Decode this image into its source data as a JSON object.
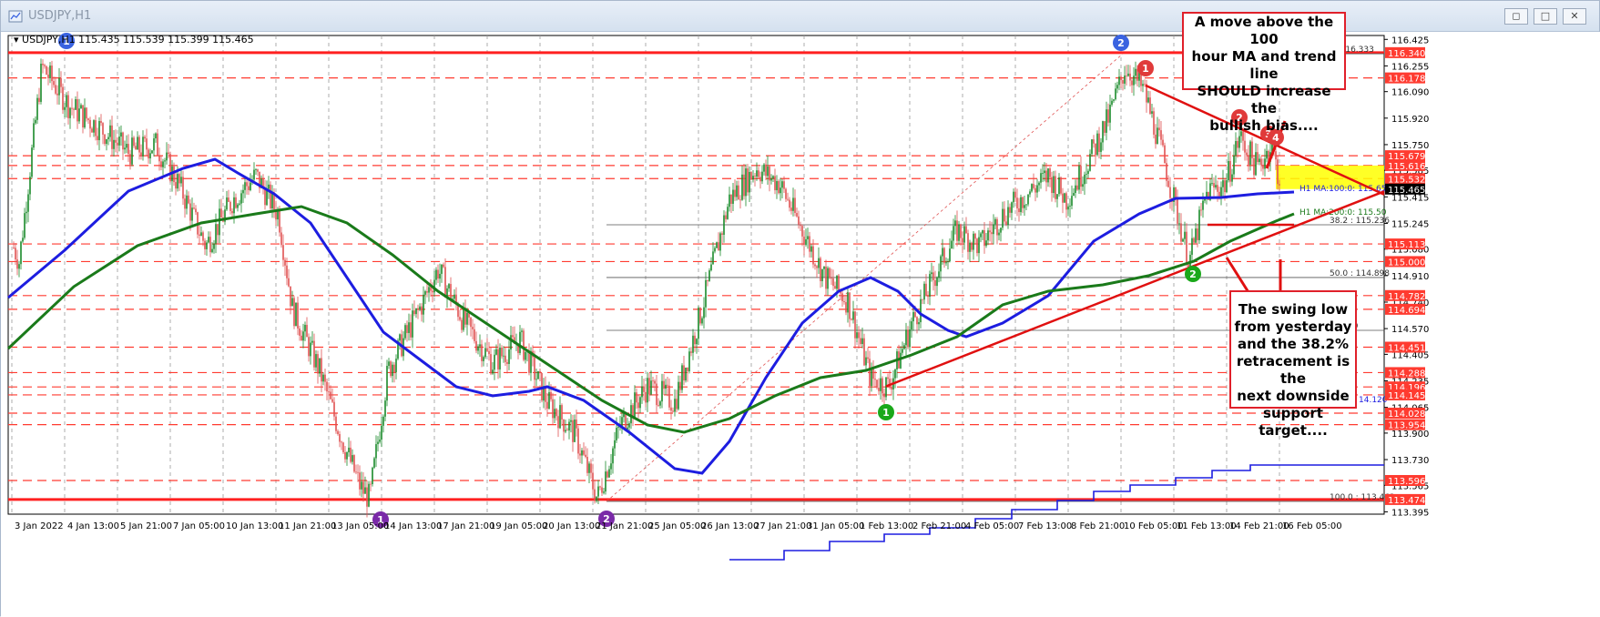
{
  "window": {
    "title": "USDJPY,H1",
    "buttons": [
      "◻",
      "□",
      "✕"
    ]
  },
  "chart_header": {
    "symbol_line": "USDJPY,H1",
    "ohlc": "115.435 115.539 115.399 115.465"
  },
  "price_axis": {
    "ticks": [
      "116.425",
      "116.255",
      "116.090",
      "115.920",
      "115.750",
      "115.585",
      "115.415",
      "115.245",
      "115.080",
      "114.910",
      "114.740",
      "114.570",
      "114.405",
      "114.235",
      "114.065",
      "113.900",
      "113.730",
      "113.565",
      "113.395"
    ],
    "tagged_levels": [
      {
        "label": "116.340",
        "value": 116.34,
        "color": "#ff3b30"
      },
      {
        "label": "116.178",
        "value": 116.178,
        "color": "#ff3b30"
      },
      {
        "label": "115.679",
        "value": 115.679,
        "color": "#ff3b30"
      },
      {
        "label": "115.616",
        "value": 115.616,
        "color": "#ff3b30"
      },
      {
        "label": "115.532",
        "value": 115.532,
        "color": "#ff3b30"
      },
      {
        "label": "115.465",
        "value": 115.465,
        "color": "#000000"
      },
      {
        "label": "115.113",
        "value": 115.113,
        "color": "#ff3b30"
      },
      {
        "label": "115.000",
        "value": 115.0,
        "color": "#ff3b30"
      },
      {
        "label": "114.782",
        "value": 114.782,
        "color": "#ff3b30"
      },
      {
        "label": "114.694",
        "value": 114.694,
        "color": "#ff3b30"
      },
      {
        "label": "114.451",
        "value": 114.451,
        "color": "#ff3b30"
      },
      {
        "label": "114.288",
        "value": 114.288,
        "color": "#ff3b30"
      },
      {
        "label": "114.196",
        "value": 114.196,
        "color": "#ff3b30"
      },
      {
        "label": "114.145",
        "value": 114.145,
        "color": "#ff3b30"
      },
      {
        "label": "114.028",
        "value": 114.028,
        "color": "#ff3b30"
      },
      {
        "label": "113.954",
        "value": 113.954,
        "color": "#ff3b30"
      },
      {
        "label": "113.596",
        "value": 113.596,
        "color": "#ff3b30"
      },
      {
        "label": "113.474",
        "value": 113.474,
        "color": "#ff3b30"
      }
    ]
  },
  "time_axis": {
    "labels": [
      "3 Jan 2022",
      "4 Jan 13:00",
      "5 Jan 21:00",
      "7 Jan 05:00",
      "10 Jan 13:00",
      "11 Jan 21:00",
      "13 Jan 05:00",
      "14 Jan 13:00",
      "17 Jan 21:00",
      "19 Jan 05:00",
      "20 Jan 13:00",
      "21 Jan 21:00",
      "25 Jan 05:00",
      "26 Jan 13:00",
      "27 Jan 21:00",
      "31 Jan 05:00",
      "1 Feb 13:00",
      "2 Feb 21:00",
      "4 Feb 05:00",
      "7 Feb 13:00",
      "8 Feb 21:00",
      "10 Feb 05:00",
      "11 Feb 13:00",
      "14 Feb 21:00",
      "16 Feb 05:00"
    ]
  },
  "indicators": {
    "ma100_label": "H1 MA:100:0: 115.659",
    "ma200_label": "H1 MA:200:0: 115.50",
    "ma100_color": "#1d1de0",
    "ma200_color": "#1a7a1a"
  },
  "fib_labels": {
    "top": "0: 116.333",
    "f382": "38.2 : 115.236",
    "f50": "50.0 : 114.898",
    "f618": "14.559",
    "low": "14.120",
    "bottom": "100.0 : 113.462"
  },
  "markers": [
    {
      "text": "1",
      "color": "#3a63e0"
    },
    {
      "text": "2",
      "color": "#3a63e0"
    },
    {
      "text": "1",
      "color": "#e03a3a"
    },
    {
      "text": "2",
      "color": "#e03a3a"
    },
    {
      "text": "3",
      "color": "#e03a3a"
    },
    {
      "text": "4",
      "color": "#e03a3a"
    },
    {
      "text": "1",
      "color": "#1aa81a"
    },
    {
      "text": "2",
      "color": "#1aa81a"
    },
    {
      "text": "1",
      "color": "#7a2aa8"
    },
    {
      "text": "2",
      "color": "#7a2aa8"
    }
  ],
  "annotations": {
    "top_note": [
      "A move above the 100",
      "hour MA and trend line",
      "SHOULD increase the",
      "bullish bias...."
    ],
    "bottom_note": [
      "The swing low",
      "from yesterday",
      "and the 38.2%",
      "retracement is the",
      "next downside",
      "support target...."
    ]
  },
  "colors": {
    "candle_up": "#1a8a2a",
    "candle_down": "#e05252",
    "level_line": "#ff3b30",
    "zone_fill": "#ffff00"
  }
}
